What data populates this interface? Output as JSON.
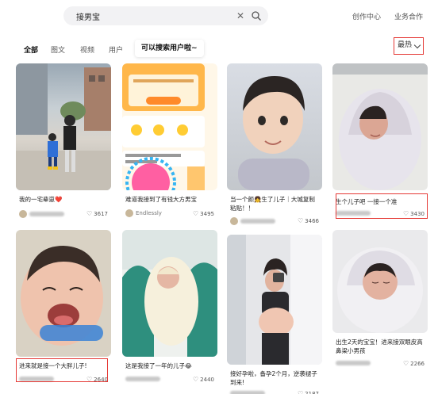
{
  "search": {
    "query": "接男宝"
  },
  "header": {
    "links": [
      "创作中心",
      "业务合作"
    ]
  },
  "tabs": {
    "items": [
      "全部",
      "图文",
      "视频",
      "用户"
    ],
    "promo": "可以搜索用户啦~",
    "sort": "最热"
  },
  "cards": [
    {
      "title": "我的一宅辈崽❤️",
      "user": "",
      "likes": "3617"
    },
    {
      "title": "难道我接到了有钱大方男宝",
      "user": "Endlessly",
      "likes": "3495"
    },
    {
      "title": "当一个颜👧生了儿子｜大城复制粘贴！！",
      "user": "",
      "likes": "3466"
    },
    {
      "title": "生个儿子吧 一接一个准",
      "user": "",
      "likes": "3430"
    },
    {
      "title": "进来就是接一个大胖儿子!",
      "user": "",
      "likes": "2640"
    },
    {
      "title": "这是我接了一年的儿子😂",
      "user": "",
      "likes": "2440"
    },
    {
      "title": "接好孕啦，备孕2个月，逆袭褪子到来!",
      "user": "",
      "likes": "2187"
    },
    {
      "title": "出生2天的宝宝！进来接双眼皮高鼻梁小男孩",
      "user": "",
      "likes": "2266"
    }
  ],
  "colors": {
    "accent": "#e53935",
    "bg": "#ffffff"
  }
}
